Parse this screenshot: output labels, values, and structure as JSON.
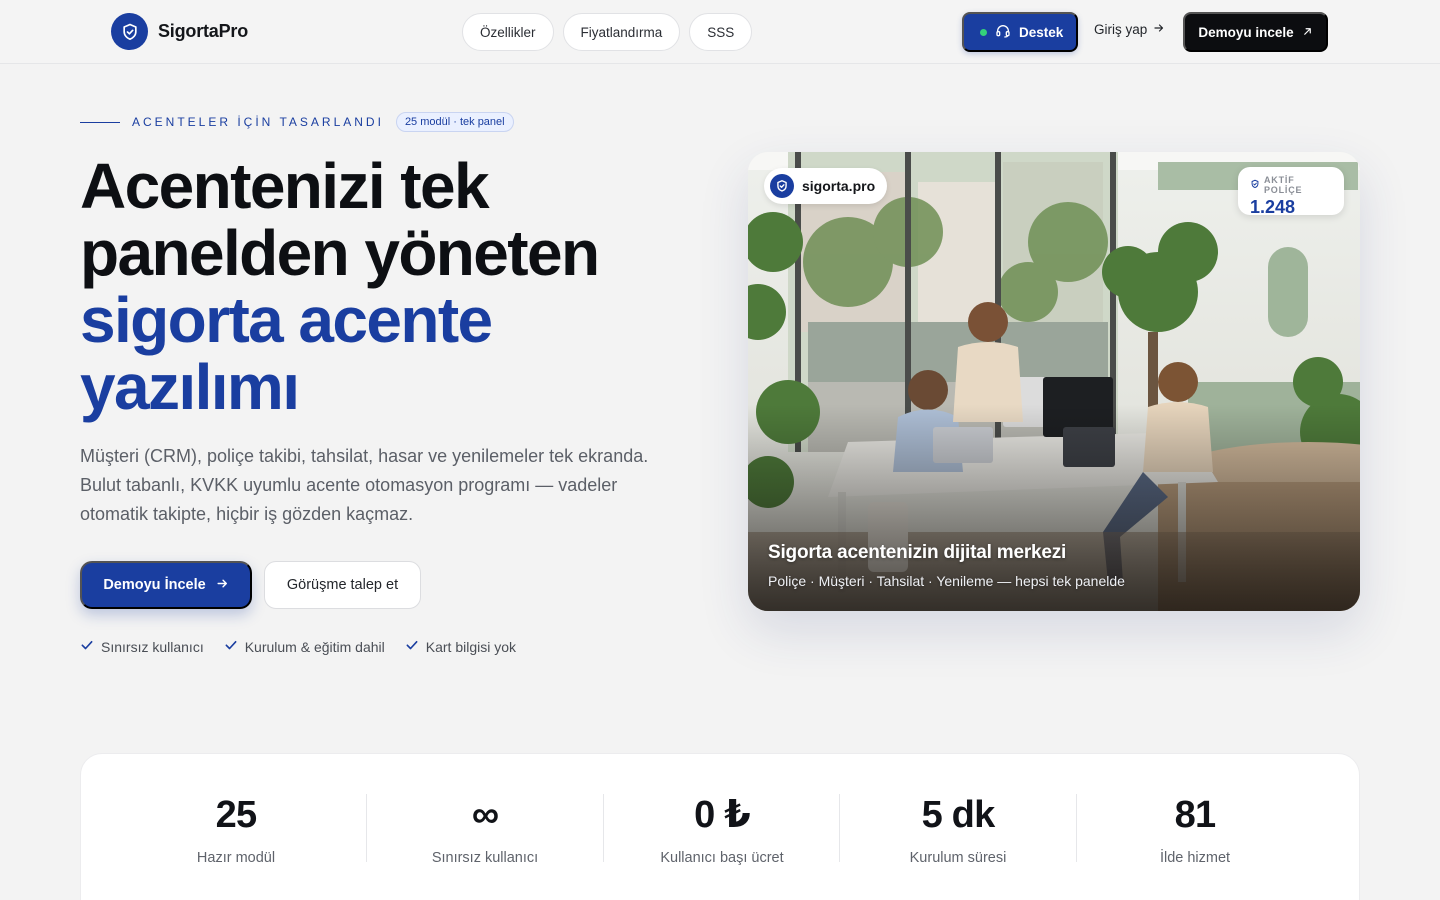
{
  "brand": {
    "name": "SigortaPro"
  },
  "nav": {
    "items": [
      "Özellikler",
      "Fiyatlandırma",
      "SSS"
    ]
  },
  "header": {
    "support_label": "Destek",
    "login_label": "Giriş yap",
    "demo_label": "Demoyu incele"
  },
  "hero": {
    "eyebrow": "ACENTELER İÇİN TASARLANDI",
    "eyebrow_badge": "25 modül · tek panel",
    "headline_lines": [
      "Acentenizi tek",
      "panelden yöneten"
    ],
    "headline_accent_lines": [
      "sigorta acente",
      "yazılımı"
    ],
    "lead": "Müşteri (CRM), poliçe takibi, tahsilat, hasar ve yenilemeler tek ekranda. Bulut tabanlı, KVKK uyumlu acente otomasyon programı — vadeler otomatik takipte, hiçbir iş gözden kaçmaz.",
    "cta_primary": "Demoyu İncele",
    "cta_secondary": "Görüşme talep et",
    "checks": [
      "Sınırsız kullanıcı",
      "Kurulum & eğitim dahil",
      "Kart bilgisi yok"
    ]
  },
  "card": {
    "brand": "sigorta.pro",
    "badge_label": "AKTİF POLİÇE",
    "badge_value": "1.248",
    "caption_title": "Sigorta acentenizin dijital merkezi",
    "caption_sub": "Poliçe · Müşteri · Tahsilat · Yenileme — hepsi tek panelde"
  },
  "stats": [
    {
      "value": "25",
      "label": "Hazır modül"
    },
    {
      "value": "∞",
      "label": "Sınırsız kullanıcı"
    },
    {
      "value": "0 ₺",
      "label": "Kullanıcı başı ücret"
    },
    {
      "value": "5 dk",
      "label": "Kurulum süresi"
    },
    {
      "value": "81",
      "label": "İlde hizmet"
    }
  ],
  "colors": {
    "brand_blue": "#1a3ea0",
    "live_green": "#34d17a",
    "dark": "#0c0d10"
  }
}
